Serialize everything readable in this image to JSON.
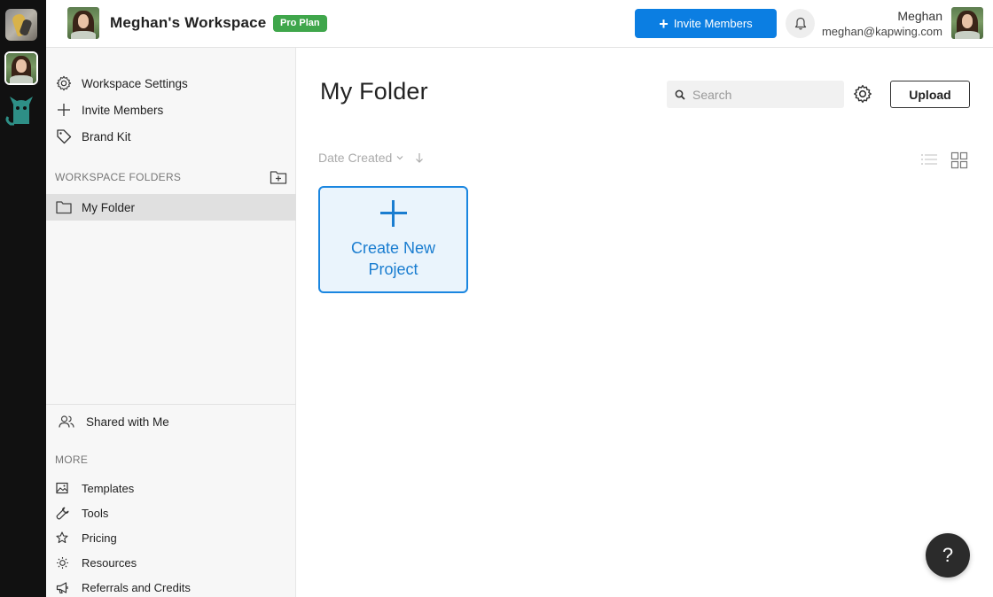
{
  "header": {
    "workspace_title": "Meghan's Workspace",
    "plan_badge": "Pro Plan",
    "invite_button_label": "Invite Members",
    "user_name": "Meghan",
    "user_email": "meghan@kapwing.com"
  },
  "sidebar": {
    "top_items": [
      {
        "label": "Workspace Settings",
        "icon": "gear-icon"
      },
      {
        "label": "Invite Members",
        "icon": "plus-icon"
      },
      {
        "label": "Brand Kit",
        "icon": "tag-icon"
      }
    ],
    "folders_heading": "WORKSPACE FOLDERS",
    "folders": [
      {
        "label": "My Folder",
        "icon": "folder-icon",
        "selected": true
      }
    ],
    "shared_label": "Shared with Me",
    "more_heading": "MORE",
    "more_items": [
      {
        "label": "Templates",
        "icon": "image-icon"
      },
      {
        "label": "Tools",
        "icon": "wrench-icon"
      },
      {
        "label": "Pricing",
        "icon": "star-icon"
      },
      {
        "label": "Resources",
        "icon": "lightbulb-icon"
      },
      {
        "label": "Referrals and Credits",
        "icon": "megaphone-icon"
      }
    ]
  },
  "main": {
    "title": "My Folder",
    "search_placeholder": "Search",
    "upload_label": "Upload",
    "sort_label": "Date Created",
    "create_card_label": "Create New Project",
    "help_label": "?"
  },
  "colors": {
    "accent": "#0b7ee2",
    "pro_badge": "#3fa64b",
    "create_card_bg": "#eaf4fc",
    "create_card_border": "#1a86e0",
    "rail_bg": "#111111"
  }
}
